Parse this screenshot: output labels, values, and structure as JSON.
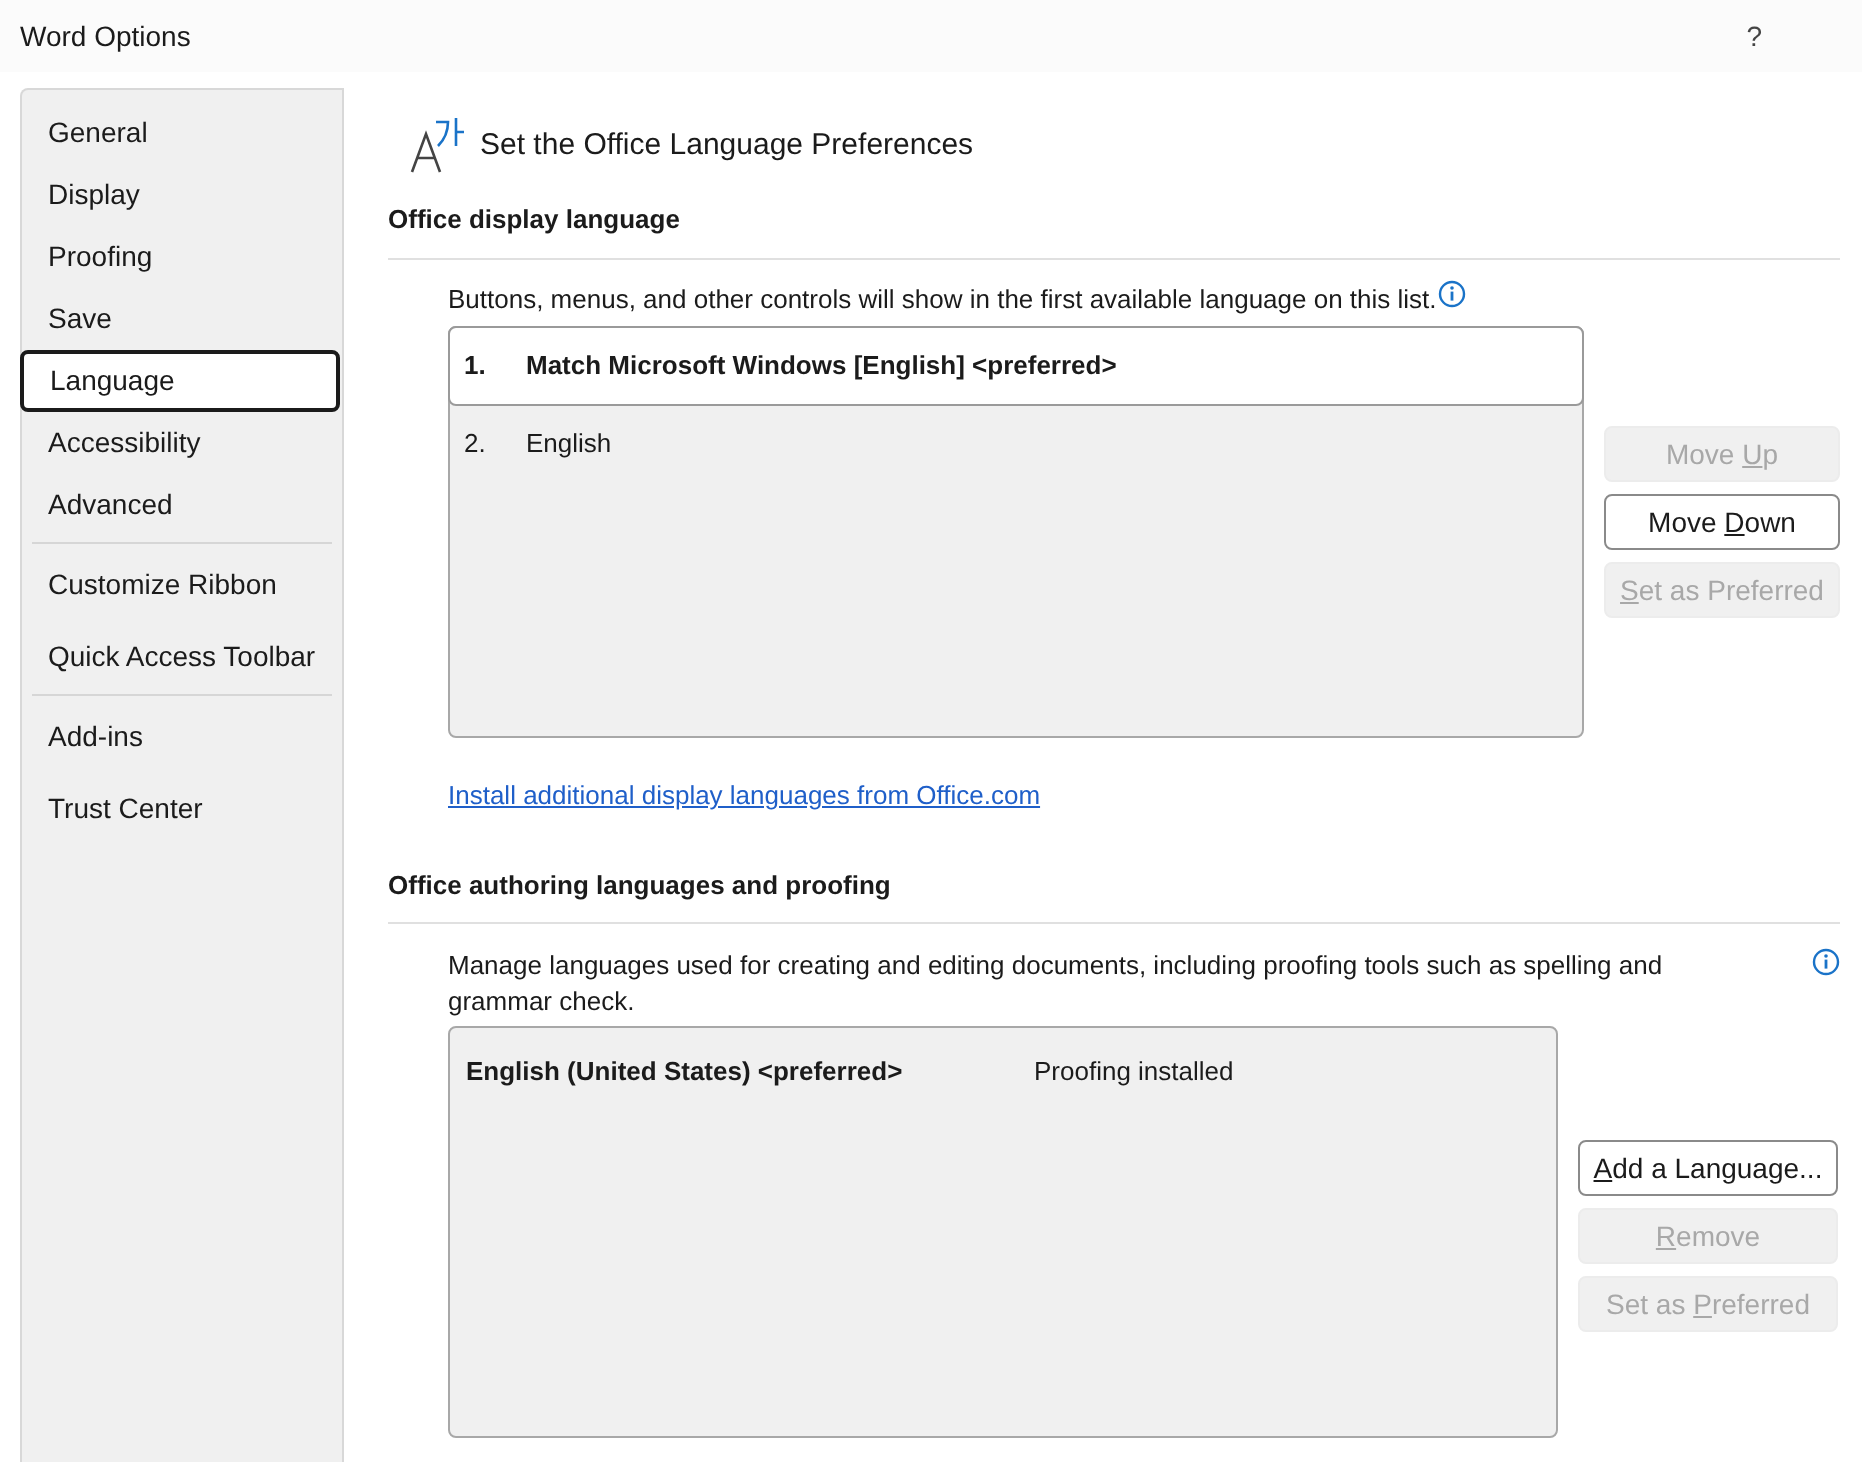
{
  "window": {
    "title": "Word Options",
    "help": "?"
  },
  "sidebar": {
    "groups": [
      {
        "items": [
          {
            "label": "General",
            "selected": false
          },
          {
            "label": "Display",
            "selected": false
          },
          {
            "label": "Proofing",
            "selected": false
          },
          {
            "label": "Save",
            "selected": false
          },
          {
            "label": "Language",
            "selected": true
          },
          {
            "label": "Accessibility",
            "selected": false
          },
          {
            "label": "Advanced",
            "selected": false
          }
        ]
      },
      {
        "items": [
          {
            "label": "Customize Ribbon",
            "selected": false
          },
          {
            "label": "Quick Access Toolbar",
            "selected": false
          }
        ]
      },
      {
        "items": [
          {
            "label": "Add-ins",
            "selected": false
          },
          {
            "label": "Trust Center",
            "selected": false
          }
        ]
      }
    ]
  },
  "page_title": "Set the Office Language Preferences",
  "display_language": {
    "heading": "Office display language",
    "description": "Buttons, menus, and other controls will show in the first available language on this list.",
    "list": [
      {
        "number": "1.",
        "name": "Match Microsoft Windows [English] <preferred>",
        "selected": true
      },
      {
        "number": "2.",
        "name": "English",
        "selected": false
      }
    ],
    "buttons": [
      {
        "pre": "Move ",
        "key": "U",
        "post": "p",
        "disabled": true
      },
      {
        "pre": "Move ",
        "key": "D",
        "post": "own",
        "disabled": false
      },
      {
        "key": "S",
        "post": "et as Preferred",
        "disabled": true
      }
    ],
    "link": "Install additional display languages from Office.com"
  },
  "authoring": {
    "heading": "Office authoring languages and proofing",
    "description": "Manage languages used for creating and editing documents, including proofing tools such as spelling and grammar check.",
    "list": [
      {
        "name": "English (United States) <preferred>",
        "status": "Proofing installed"
      }
    ],
    "buttons": [
      {
        "key": "A",
        "post": "dd a Language...",
        "disabled": false
      },
      {
        "key": "R",
        "post": "emove",
        "disabled": true
      },
      {
        "pre": "Set as ",
        "key": "P",
        "post": "referred",
        "disabled": true
      }
    ]
  }
}
